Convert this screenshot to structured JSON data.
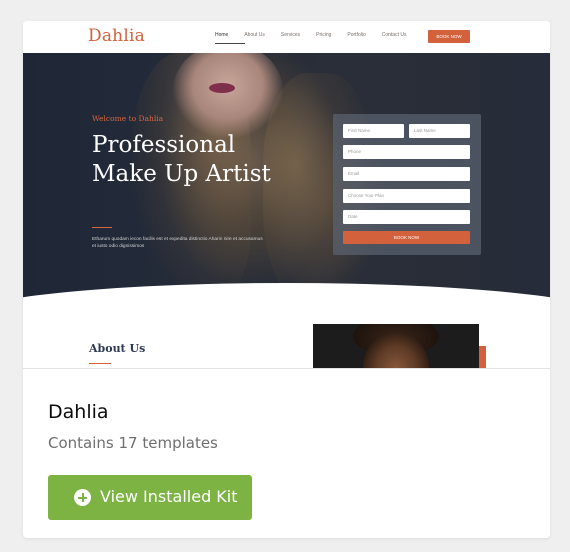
{
  "preview": {
    "logo": "Dahlia",
    "nav": [
      "Home",
      "About Us",
      "Services",
      "Pricing",
      "Portfolio",
      "Contact Us"
    ],
    "book_now": "BOOK NOW",
    "welcome": "Welcome to Dahlia",
    "headline": "Professional Make Up Artist",
    "lorem": "Etharum quodam iecon facilis est et expedita distinctio Aharin nire et accusamus et iusto odio dignissimos",
    "form": {
      "first_name": "First Name",
      "last_name": "Last Name",
      "phone": "Phone",
      "email": "Email",
      "plan": "Choose Your Plan",
      "date": "Date",
      "submit": "BOOK NOW"
    },
    "about_heading": "About Us"
  },
  "kit": {
    "name": "Dahlia",
    "subtitle": "Contains 17 templates",
    "button_label": "View Installed Kit",
    "button_icon": "plus-circle-icon"
  },
  "colors": {
    "accent": "#d2613c",
    "button": "#7cb342",
    "hero_bg": "#252b38"
  }
}
